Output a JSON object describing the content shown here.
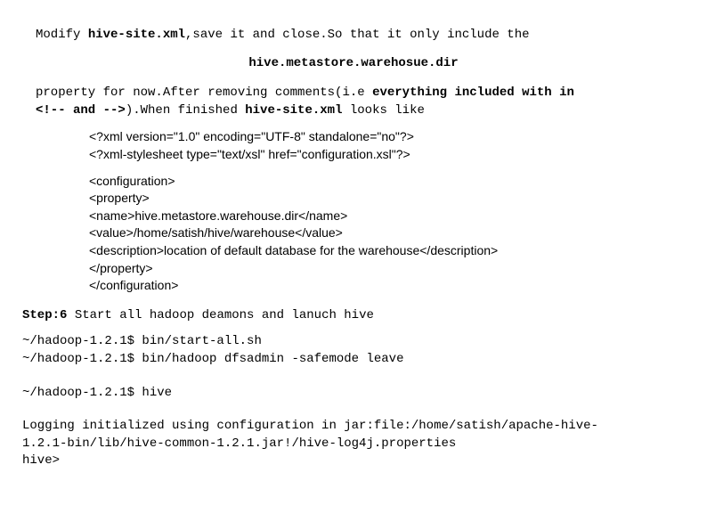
{
  "intro": {
    "p1a": "Modify ",
    "p1b": "hive-site.xml",
    "p1c": ",save it and close.So that it only include the"
  },
  "centered_key": "hive.metastore.warehosue.dir",
  "para2": {
    "a": "property for now.After removing comments(i.e ",
    "b": "everything included with in",
    "c": "<!--  and -->",
    "d": ").When finished ",
    "e": "hive-site.xml",
    "f": " looks like"
  },
  "xml": {
    "l1": "<?xml version=\"1.0\" encoding=\"UTF-8\" standalone=\"no\"?>",
    "l2": "<?xml-stylesheet type=\"text/xsl\" href=\"configuration.xsl\"?>",
    "l3": "<configuration>",
    "l4": " <property>",
    "l5": "  <name>hive.metastore.warehouse.dir</name>",
    "l6": "  <value>/home/satish/hive/warehouse</value>",
    "l7": "  <description>location of default database for the warehouse</description>",
    "l8": " </property>",
    "l9": "</configuration>"
  },
  "step6": {
    "label": "Step:6",
    "text": " Start all hadoop deamons and lanuch hive"
  },
  "cmds": {
    "c1": "~/hadoop-1.2.1$ bin/start-all.sh",
    "c2": "~/hadoop-1.2.1$ bin/hadoop dfsadmin -safemode leave",
    "c3": "~/hadoop-1.2.1$ hive"
  },
  "log": {
    "l1": "Logging initialized using configuration in jar:file:/home/satish/apache-hive-",
    "l2": "1.2.1-bin/lib/hive-common-1.2.1.jar!/hive-log4j.properties",
    "l3": "hive>"
  }
}
